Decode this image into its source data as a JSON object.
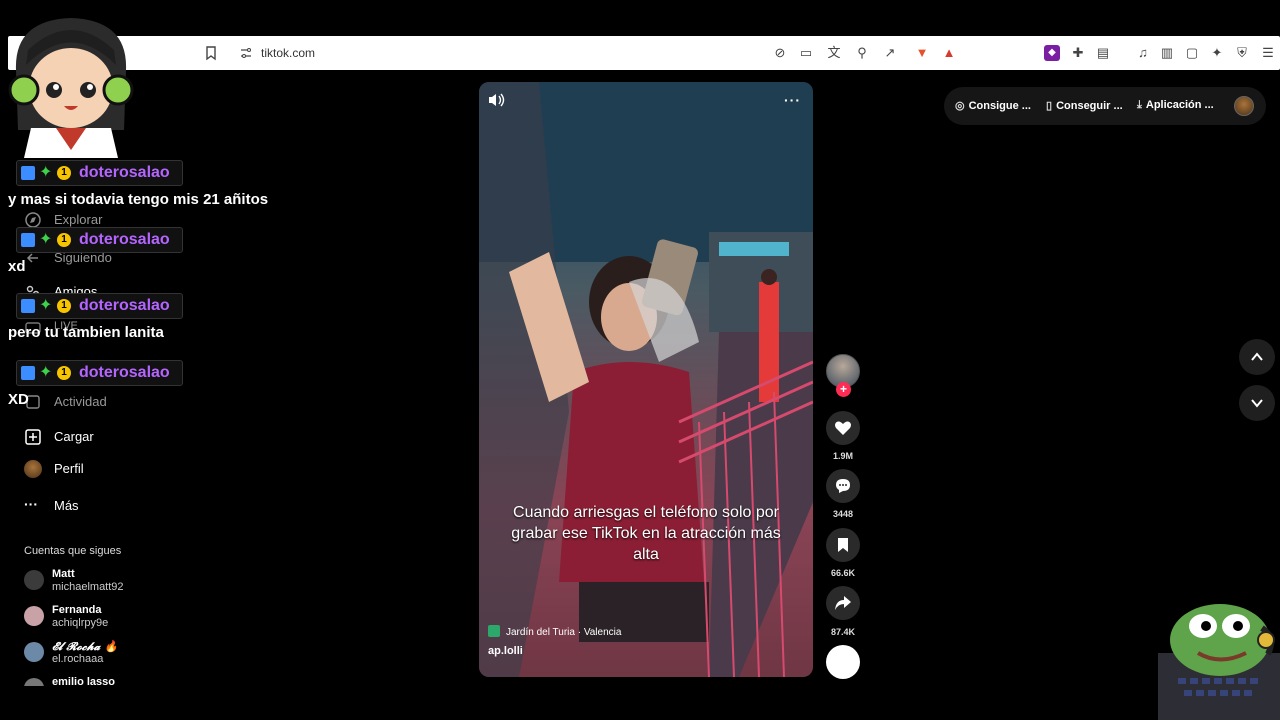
{
  "browser": {
    "url": "tiktok.com",
    "icons": [
      "bookmark-icon",
      "site-settings-icon",
      "no-translate-icon",
      "cast-icon",
      "translate-icon",
      "zoom-icon",
      "share-icon",
      "brave-shield-icon",
      "rewards-icon",
      "extension-icon",
      "puzzle-icon",
      "reader-icon",
      "music-icon",
      "sidebar-icon",
      "wallet-icon",
      "ai-icon",
      "vpn-icon",
      "menu-icon"
    ]
  },
  "top_pills": {
    "items": [
      {
        "label": "Consigue ...",
        "icon": "coin-icon"
      },
      {
        "label": "Conseguir ...",
        "icon": "phone-icon"
      },
      {
        "label": "Aplicación ...",
        "icon": "download-icon"
      }
    ]
  },
  "sidebar": {
    "items": [
      {
        "label": "Explorar",
        "icon": "compass-icon"
      },
      {
        "label": "Siguiendo",
        "icon": "following-icon"
      },
      {
        "label": "Amigos",
        "icon": "friends-icon"
      },
      {
        "label": "LIVE",
        "icon": "live-icon"
      },
      {
        "label": "Actividad",
        "icon": "activity-icon"
      },
      {
        "label": "Cargar",
        "icon": "upload-icon"
      },
      {
        "label": "Perfil",
        "icon": "profile-icon"
      },
      {
        "label": "Más",
        "icon": "more-icon"
      }
    ],
    "following_title": "Cuentas que sigues",
    "accounts": [
      {
        "name": "Matt",
        "handle": "michaelmatt92"
      },
      {
        "name": "Fernanda",
        "handle": "achiqlrpy9e"
      },
      {
        "name": "𝓔𝓵 𝓡𝓸𝓬𝓱𝓪 🔥",
        "handle": "el.rochaaa"
      },
      {
        "name": "emilio lasso",
        "handle": ""
      }
    ]
  },
  "chat": {
    "username": "doterosalao",
    "messages": [
      "y mas si todavia tengo mis 21 añitos",
      "xd",
      "pero tu tambien lanita",
      "XD"
    ]
  },
  "video": {
    "caption": "Cuando arriesgas el teléfono solo por grabar ese TikTok en la atracción más alta",
    "location": "Jardín del Turia · Valencia",
    "author": "ap.lolli",
    "likes": "1.9M",
    "comments": "3448",
    "saves": "66.6K",
    "shares": "87.4K"
  },
  "colors": {
    "accent": "#fe2c55",
    "chat_name": "#b565ff",
    "background": "#000000"
  }
}
